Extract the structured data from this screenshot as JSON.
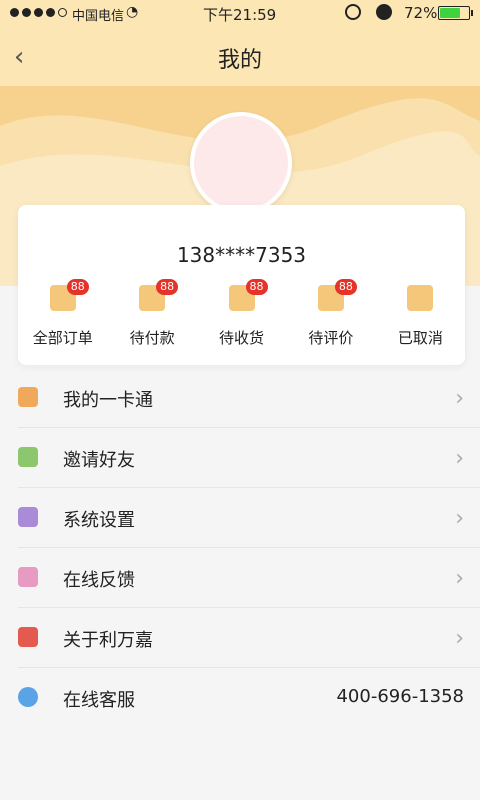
{
  "status_bar": {
    "carrier": "中国电信",
    "time": "下午21:59",
    "battery": "72%",
    "battery_level": 0.72
  },
  "header": {
    "title": "我的"
  },
  "profile": {
    "phone": "138****7353"
  },
  "orders": [
    {
      "label": "全部订单",
      "badge": "88",
      "icon": "clipboard-icon"
    },
    {
      "label": "待付款",
      "badge": "88",
      "icon": "wallet-icon"
    },
    {
      "label": "待收货",
      "badge": "88",
      "icon": "package-icon"
    },
    {
      "label": "待评价",
      "badge": "88",
      "icon": "flower-icon"
    },
    {
      "label": "已取消",
      "badge": "",
      "icon": "cancel-clipboard-icon"
    }
  ],
  "menu": [
    {
      "label": "我的一卡通",
      "icon": "crown-icon",
      "color": "#f0a95a"
    },
    {
      "label": "邀请好友",
      "icon": "add-friend-icon",
      "color": "#8cc66d"
    },
    {
      "label": "系统设置",
      "icon": "gear-icon",
      "color": "#a98bd8"
    },
    {
      "label": "在线反馈",
      "icon": "feedback-icon",
      "color": "#e79ac2"
    },
    {
      "label": "关于利万嘉",
      "icon": "info-icon",
      "color": "#e55a4f"
    },
    {
      "label": "在线客服",
      "icon": "headset-icon",
      "color": "#5aa3e6",
      "value": "400-696-1358"
    }
  ]
}
